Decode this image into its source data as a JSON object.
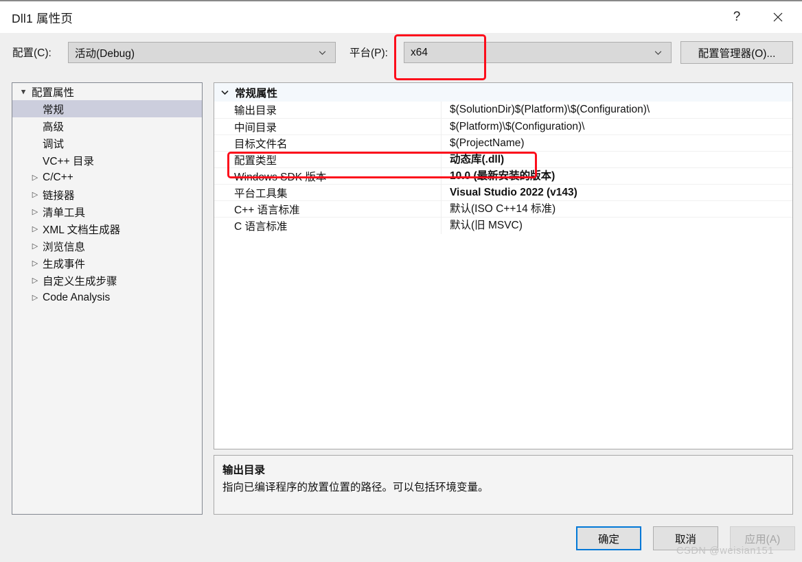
{
  "window": {
    "title": "Dll1 属性页",
    "help_icon": "question-mark-icon",
    "close_icon": "close-icon"
  },
  "config_bar": {
    "config_label": "配置(C):",
    "config_value": "活动(Debug)",
    "platform_label": "平台(P):",
    "platform_value": "x64",
    "config_manager_button": "配置管理器(O)..."
  },
  "tree": {
    "items": [
      {
        "label": "配置属性",
        "level": 0,
        "glyph": "▲",
        "expanded": true,
        "selected": false
      },
      {
        "label": "常规",
        "level": 1,
        "glyph": "",
        "expanded": false,
        "selected": true
      },
      {
        "label": "高级",
        "level": 1,
        "glyph": "",
        "expanded": false,
        "selected": false
      },
      {
        "label": "调试",
        "level": 1,
        "glyph": "",
        "expanded": false,
        "selected": false
      },
      {
        "label": "VC++ 目录",
        "level": 1,
        "glyph": "",
        "expanded": false,
        "selected": false
      },
      {
        "label": "C/C++",
        "level": 1,
        "glyph": "▷",
        "expanded": false,
        "selected": false
      },
      {
        "label": "链接器",
        "level": 1,
        "glyph": "▷",
        "expanded": false,
        "selected": false
      },
      {
        "label": "清单工具",
        "level": 1,
        "glyph": "▷",
        "expanded": false,
        "selected": false
      },
      {
        "label": "XML 文档生成器",
        "level": 1,
        "glyph": "▷",
        "expanded": false,
        "selected": false
      },
      {
        "label": "浏览信息",
        "level": 1,
        "glyph": "▷",
        "expanded": false,
        "selected": false
      },
      {
        "label": "生成事件",
        "level": 1,
        "glyph": "▷",
        "expanded": false,
        "selected": false
      },
      {
        "label": "自定义生成步骤",
        "level": 1,
        "glyph": "▷",
        "expanded": false,
        "selected": false
      },
      {
        "label": "Code Analysis",
        "level": 1,
        "glyph": "▷",
        "expanded": false,
        "selected": false
      }
    ]
  },
  "grid": {
    "section_title": "常规属性",
    "section_chevron": "chevron-down-icon",
    "rows": [
      {
        "name": "输出目录",
        "value": "$(SolutionDir)$(Platform)\\$(Configuration)\\",
        "bold": false
      },
      {
        "name": "中间目录",
        "value": "$(Platform)\\$(Configuration)\\",
        "bold": false
      },
      {
        "name": "目标文件名",
        "value": "$(ProjectName)",
        "bold": false
      },
      {
        "name": "配置类型",
        "value": "动态库(.dll)",
        "bold": true
      },
      {
        "name": "Windows SDK 版本",
        "value": "10.0 (最新安装的版本)",
        "bold": true
      },
      {
        "name": "平台工具集",
        "value": "Visual Studio 2022 (v143)",
        "bold": true
      },
      {
        "name": "C++ 语言标准",
        "value": "默认(ISO C++14 标准)",
        "bold": false
      },
      {
        "name": "C 语言标准",
        "value": "默认(旧 MSVC)",
        "bold": false
      }
    ]
  },
  "description": {
    "title": "输出目录",
    "text": "指向已编译程序的放置位置的路径。可以包括环境变量。"
  },
  "footer": {
    "ok": "确定",
    "cancel": "取消",
    "apply": "应用(A)"
  },
  "watermark": "CSDN @weisian151",
  "colors": {
    "accent": "#0078d7",
    "annotation": "#fc0d1b",
    "dialog_bg": "#efefef",
    "tree_selected": "#cccedd",
    "grid_header": "#f4f8fc"
  }
}
